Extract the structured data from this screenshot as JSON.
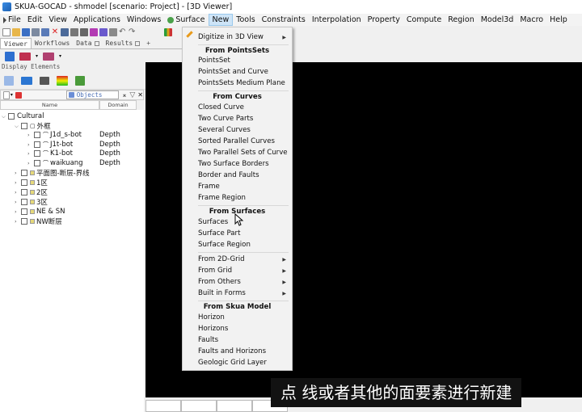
{
  "window": {
    "title": "SKUA-GOCAD - shmodel [scenario: Project] - [3D Viewer]"
  },
  "menubar": [
    {
      "label": "File"
    },
    {
      "label": "Edit"
    },
    {
      "label": "View"
    },
    {
      "label": "Applications"
    },
    {
      "label": "Windows"
    },
    {
      "label": "Surface"
    },
    {
      "label": "New"
    },
    {
      "label": "Tools"
    },
    {
      "label": "Constraints"
    },
    {
      "label": "Interpolation"
    },
    {
      "label": "Property"
    },
    {
      "label": "Compute"
    },
    {
      "label": "Region"
    },
    {
      "label": "Model3d"
    },
    {
      "label": "Macro"
    },
    {
      "label": "Help"
    }
  ],
  "tabs": [
    {
      "label": "Viewer"
    },
    {
      "label": "Workflows"
    },
    {
      "label": "Data"
    },
    {
      "label": "Results"
    },
    {
      "label": "+"
    }
  ],
  "panel": {
    "title": "Display Elements",
    "objects_tab": "Objects",
    "col_name": "Name",
    "col_domain": "Domain"
  },
  "tree": [
    {
      "label": "Cultural",
      "domain": ""
    },
    {
      "label": "外框",
      "domain": ""
    },
    {
      "label": "J1d_s-bot",
      "domain": "Depth"
    },
    {
      "label": "J1t-bot",
      "domain": "Depth"
    },
    {
      "label": "K1-bot",
      "domain": "Depth"
    },
    {
      "label": "waikuang",
      "domain": "Depth"
    },
    {
      "label": "平面图-断层-界线",
      "domain": ""
    },
    {
      "label": "1区",
      "domain": ""
    },
    {
      "label": "2区",
      "domain": ""
    },
    {
      "label": "3区",
      "domain": ""
    },
    {
      "label": "NE & SN",
      "domain": ""
    },
    {
      "label": "NW断层",
      "domain": ""
    }
  ],
  "menu": {
    "top_item": "Digitize in 3D View",
    "h_pointsets": "From PointsSets",
    "pointsets": [
      "PointsSet",
      "PointsSet and Curve",
      "PointsSets Medium Plane"
    ],
    "h_curves": "From Curves",
    "curves": [
      "Closed Curve",
      "Two Curve Parts",
      "Several Curves",
      "Sorted Parallel Curves",
      "Two Parallel Sets of Curve",
      "Two Surface Borders",
      "Border and Faults",
      "Frame",
      "Frame Region"
    ],
    "h_surfaces": "From Surfaces",
    "surfaces": [
      "Surfaces",
      "Surface Part",
      "Surface Region"
    ],
    "submenus": [
      "From 2D-Grid",
      "From Grid",
      "From Others",
      "Built in Forms"
    ],
    "h_skua": "From Skua Model",
    "skua": [
      "Horizon",
      "Horizons",
      "Faults",
      "Faults and Horizons",
      "Geologic Grid Layer"
    ]
  },
  "subtitle": "点 线或者其他的面要素进行新建",
  "colors": {
    "menu_highlight": "#cde4f7",
    "viewer_bg": "#000000",
    "objects_text": "#4a6fb5"
  }
}
